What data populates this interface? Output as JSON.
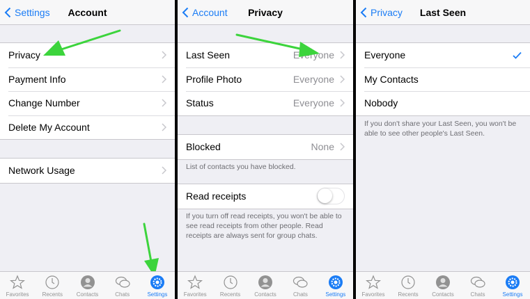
{
  "colors": {
    "accent": "#1a7cf5",
    "arrow": "#3cd43c",
    "background": "#efeff4"
  },
  "screens": [
    {
      "back_label": "Settings",
      "title": "Account",
      "groups": [
        [
          "Privacy",
          "Payment Info",
          "Change Number",
          "Delete My Account"
        ],
        [
          "Network Usage"
        ]
      ]
    },
    {
      "back_label": "Account",
      "title": "Privacy",
      "rows": [
        {
          "label": "Last Seen",
          "value": "Everyone"
        },
        {
          "label": "Profile Photo",
          "value": "Everyone"
        },
        {
          "label": "Status",
          "value": "Everyone"
        }
      ],
      "blocked": {
        "label": "Blocked",
        "value": "None"
      },
      "blocked_footer": "List of contacts you have blocked.",
      "read_receipts": {
        "label": "Read receipts",
        "enabled": false
      },
      "read_receipts_footer": "If you turn off read receipts, you won't be able to see read receipts from other people. Read receipts are always sent for group chats."
    },
    {
      "back_label": "Privacy",
      "title": "Last Seen",
      "options": [
        "Everyone",
        "My Contacts",
        "Nobody"
      ],
      "selected": "Everyone",
      "footer": "If you don't share your Last Seen, you won't be able to see other people's Last Seen."
    }
  ],
  "tabbar": {
    "items": [
      {
        "label": "Favorites",
        "icon": "star-icon"
      },
      {
        "label": "Recents",
        "icon": "clock-icon"
      },
      {
        "label": "Contacts",
        "icon": "contact-icon"
      },
      {
        "label": "Chats",
        "icon": "chat-bubbles-icon"
      },
      {
        "label": "Settings",
        "icon": "gear-icon"
      }
    ],
    "active": "Settings"
  }
}
